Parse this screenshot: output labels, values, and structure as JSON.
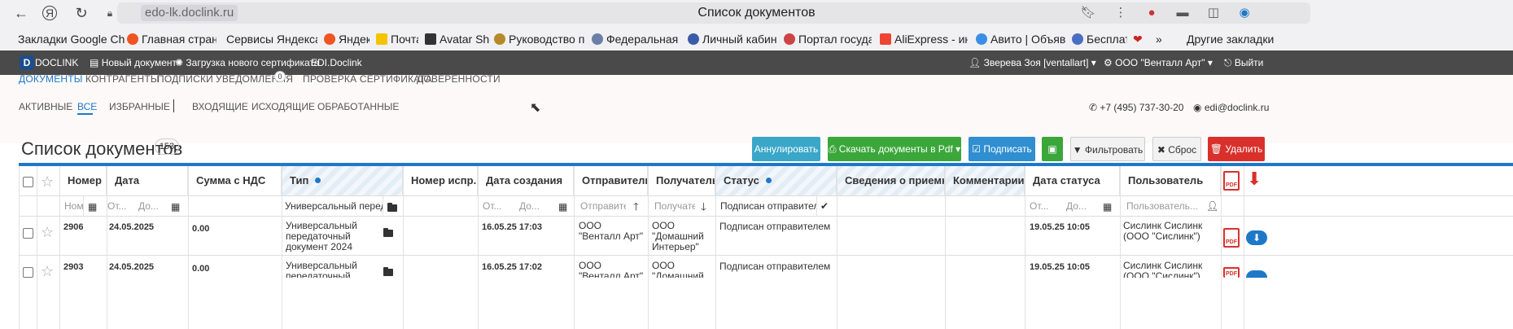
{
  "browser": {
    "url": "edo-lk.doclink.ru",
    "title": "Список документов",
    "icons": [
      "back-icon",
      "yandex-icon",
      "reload-icon",
      "lock-icon",
      "bookmark-icon",
      "more-icon",
      "extension-icon"
    ]
  },
  "bookmarks": {
    "items": [
      "Закладки Google Ch",
      "Главная страница",
      "Сервисы Яндекса",
      "Яндекс",
      "Почта",
      "Avatar Shop",
      "Руководство по п",
      "Федеральная нал",
      "Личный кабинет",
      "Портал государс",
      "AliExpress - интер",
      "Авито | Объявлен",
      "Бесплатн",
      "»",
      "Другие закладки"
    ]
  },
  "app_nav": {
    "logo": "D",
    "brand": "DOCLINK",
    "new_doc": "Новый документ",
    "upload_cert": "Загрузка нового сертификата",
    "edi": "EDI.Doclink",
    "user": "Зверева Зоя [ventallart]",
    "org": "ООО \"Венталл Арт\"",
    "logout": "Выйти"
  },
  "sections": {
    "documents": "ДОКУМЕНТЫ",
    "counterparties": "КОНТРАГЕНТЫ",
    "signatures": "ПОДПИСКИ",
    "notifications": "УВЕДОМЛЕНИЯ",
    "notifications_count": "0",
    "cert_check": "ПРОВЕРКА СЕРТИФИКАТА",
    "powers": "ДОВЕРЕННОСТИ"
  },
  "filters": {
    "active": "АКТИВНЫЕ",
    "all": "ВСЕ",
    "favorites": "ИЗБРАННЫЕ",
    "incoming": "ВХОДЯЩИЕ",
    "outgoing": "ИСХОДЯЩИЕ",
    "processed": "ОБРАБОТАННЫЕ",
    "phone": "+7 (495) 737-30-20",
    "email": "edi@doclink.ru"
  },
  "list": {
    "title": "Список документов",
    "count": "153",
    "buttons": {
      "annul": "Аннулировать",
      "download_pdf": "Скачать документы в Pdf",
      "sign": "Подписать",
      "filter": "Фильтровать",
      "reset": "Сброс",
      "delete": "Удалить"
    }
  },
  "table": {
    "headers": {
      "number": "Номер",
      "date": "Дата",
      "sum": "Сумма с НДС",
      "type": "Тип",
      "number_corr": "Номер испр.",
      "created": "Дата создания",
      "sender": "Отправитель",
      "receiver": "Получатель",
      "status": "Статус",
      "acceptance": "Сведения о приемке",
      "comments": "Комментарии",
      "status_date": "Дата статуса",
      "user": "Пользователь"
    },
    "filters": {
      "number_ph": "Ном",
      "date_from": "От...",
      "date_to": "До...",
      "type_val": "Универсальный передато",
      "created_from": "От...",
      "created_to": "До...",
      "sender_ph": "Отправите",
      "receiver_ph": "Получате",
      "status_val": "Подписан отправителем",
      "status_date_from": "От...",
      "status_date_to": "До...",
      "user_ph": "Пользователь..."
    },
    "rows": [
      {
        "number": "2906",
        "date": "24.05.2025",
        "sum": "0.00",
        "type": "Универсальный передаточный документ 2024",
        "created": "16.05.25 17:03",
        "sender": "ООО \"Венталл Арт\"",
        "receiver": "ООО \"Домашний Интерьер\"",
        "status": "Подписан отправителем",
        "status_date": "19.05.25 10:05",
        "user": "Сислинк Сислинк (ООО \"Сислинк\")"
      },
      {
        "number": "2903",
        "date": "24.05.2025",
        "sum": "0.00",
        "type": "Универсальный передаточный",
        "created": "16.05.25 17:02",
        "sender": "ООО \"Венталл Арт\"",
        "receiver": "ООО \"Домашний",
        "status": "Подписан отправителем",
        "status_date": "19.05.25 10:05",
        "user": "Сислинк Сислинк (ООО \"Сислинк\")"
      }
    ]
  },
  "colors": {
    "accent": "#1e78c8",
    "annul_btn": "#3aa7c9",
    "green_btn": "#3ba73b",
    "sign_btn": "#2f8fd0",
    "delete_btn": "#d9302c",
    "dark_nav": "#4a4a4a"
  }
}
